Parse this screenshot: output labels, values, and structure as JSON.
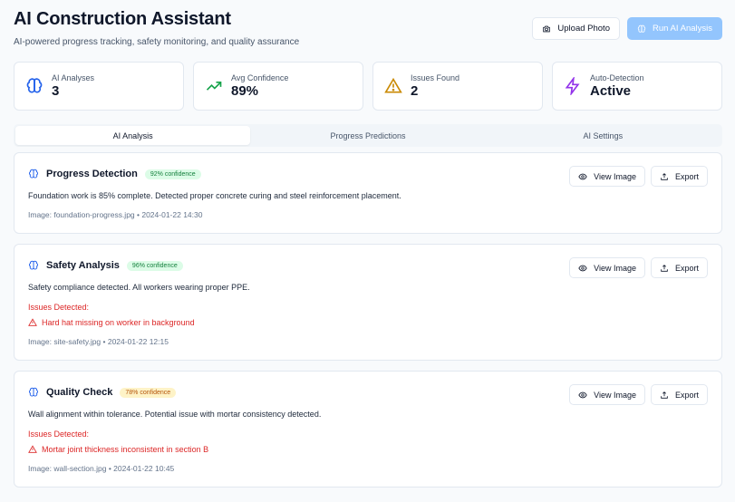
{
  "header": {
    "title": "AI Construction Assistant",
    "subtitle": "AI-powered progress tracking, safety monitoring, and quality assurance",
    "upload_label": "Upload Photo",
    "run_label": "Run AI Analysis"
  },
  "stats": [
    {
      "label": "AI Analyses",
      "value": "3",
      "icon": "brain-icon",
      "color": "#2563eb"
    },
    {
      "label": "Avg Confidence",
      "value": "89%",
      "icon": "trending-up-icon",
      "color": "#16a34a"
    },
    {
      "label": "Issues Found",
      "value": "2",
      "icon": "warning-icon",
      "color": "#ca8a04"
    },
    {
      "label": "Auto-Detection",
      "value": "Active",
      "icon": "lightning-icon",
      "color": "#9333ea"
    }
  ],
  "tabs": [
    {
      "label": "AI Analysis",
      "active": true
    },
    {
      "label": "Progress Predictions",
      "active": false
    },
    {
      "label": "AI Settings",
      "active": false
    }
  ],
  "analyses": [
    {
      "title": "Progress Detection",
      "confidence": "92% confidence",
      "description": "Foundation work is 85% complete. Detected proper concrete curing and steel reinforcement placement.",
      "meta": "Image: foundation-progress.jpg • 2024-01-22 14:30",
      "issues_label": "",
      "issues": []
    },
    {
      "title": "Safety Analysis",
      "confidence": "96% confidence",
      "description": "Safety compliance detected. All workers wearing proper PPE.",
      "meta": "Image: site-safety.jpg • 2024-01-22 12:15",
      "issues_label": "Issues Detected:",
      "issues": [
        "Hard hat missing on worker in background"
      ]
    },
    {
      "title": "Quality Check",
      "confidence": "78% confidence",
      "description": "Wall alignment within tolerance. Potential issue with mortar consistency detected.",
      "meta": "Image: wall-section.jpg • 2024-01-22 10:45",
      "issues_label": "Issues Detected:",
      "issues": [
        "Mortar joint thickness inconsistent in section B"
      ]
    }
  ],
  "card_actions": {
    "view_label": "View Image",
    "export_label": "Export"
  },
  "colors": {
    "accent": "#2563eb",
    "primary_button": "#93c5fd",
    "issue": "#dc2626"
  }
}
